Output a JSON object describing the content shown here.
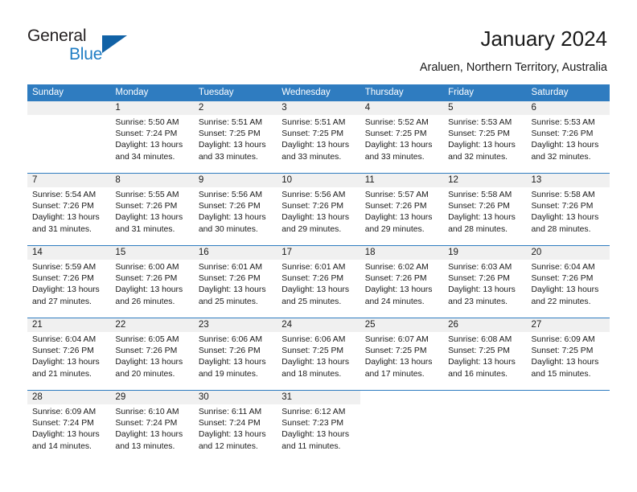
{
  "brand": {
    "name_part1": "General",
    "name_part2": "Blue",
    "accent_color": "#1162a6",
    "blue_text_color": "#1f7dc4",
    "logo_icon": "triangle-icon"
  },
  "header": {
    "title": "January 2024",
    "subtitle": "Araluen, Northern Territory, Australia"
  },
  "calendar": {
    "header_background": "#2f7cc0",
    "daynum_background": "#f0f0f0",
    "weekdays": [
      "Sunday",
      "Monday",
      "Tuesday",
      "Wednesday",
      "Thursday",
      "Friday",
      "Saturday"
    ],
    "weeks": [
      [
        {
          "day": "",
          "lines": []
        },
        {
          "day": "1",
          "lines": [
            "Sunrise: 5:50 AM",
            "Sunset: 7:24 PM",
            "Daylight: 13 hours",
            "and 34 minutes."
          ]
        },
        {
          "day": "2",
          "lines": [
            "Sunrise: 5:51 AM",
            "Sunset: 7:25 PM",
            "Daylight: 13 hours",
            "and 33 minutes."
          ]
        },
        {
          "day": "3",
          "lines": [
            "Sunrise: 5:51 AM",
            "Sunset: 7:25 PM",
            "Daylight: 13 hours",
            "and 33 minutes."
          ]
        },
        {
          "day": "4",
          "lines": [
            "Sunrise: 5:52 AM",
            "Sunset: 7:25 PM",
            "Daylight: 13 hours",
            "and 33 minutes."
          ]
        },
        {
          "day": "5",
          "lines": [
            "Sunrise: 5:53 AM",
            "Sunset: 7:25 PM",
            "Daylight: 13 hours",
            "and 32 minutes."
          ]
        },
        {
          "day": "6",
          "lines": [
            "Sunrise: 5:53 AM",
            "Sunset: 7:26 PM",
            "Daylight: 13 hours",
            "and 32 minutes."
          ]
        }
      ],
      [
        {
          "day": "7",
          "lines": [
            "Sunrise: 5:54 AM",
            "Sunset: 7:26 PM",
            "Daylight: 13 hours",
            "and 31 minutes."
          ]
        },
        {
          "day": "8",
          "lines": [
            "Sunrise: 5:55 AM",
            "Sunset: 7:26 PM",
            "Daylight: 13 hours",
            "and 31 minutes."
          ]
        },
        {
          "day": "9",
          "lines": [
            "Sunrise: 5:56 AM",
            "Sunset: 7:26 PM",
            "Daylight: 13 hours",
            "and 30 minutes."
          ]
        },
        {
          "day": "10",
          "lines": [
            "Sunrise: 5:56 AM",
            "Sunset: 7:26 PM",
            "Daylight: 13 hours",
            "and 29 minutes."
          ]
        },
        {
          "day": "11",
          "lines": [
            "Sunrise: 5:57 AM",
            "Sunset: 7:26 PM",
            "Daylight: 13 hours",
            "and 29 minutes."
          ]
        },
        {
          "day": "12",
          "lines": [
            "Sunrise: 5:58 AM",
            "Sunset: 7:26 PM",
            "Daylight: 13 hours",
            "and 28 minutes."
          ]
        },
        {
          "day": "13",
          "lines": [
            "Sunrise: 5:58 AM",
            "Sunset: 7:26 PM",
            "Daylight: 13 hours",
            "and 28 minutes."
          ]
        }
      ],
      [
        {
          "day": "14",
          "lines": [
            "Sunrise: 5:59 AM",
            "Sunset: 7:26 PM",
            "Daylight: 13 hours",
            "and 27 minutes."
          ]
        },
        {
          "day": "15",
          "lines": [
            "Sunrise: 6:00 AM",
            "Sunset: 7:26 PM",
            "Daylight: 13 hours",
            "and 26 minutes."
          ]
        },
        {
          "day": "16",
          "lines": [
            "Sunrise: 6:01 AM",
            "Sunset: 7:26 PM",
            "Daylight: 13 hours",
            "and 25 minutes."
          ]
        },
        {
          "day": "17",
          "lines": [
            "Sunrise: 6:01 AM",
            "Sunset: 7:26 PM",
            "Daylight: 13 hours",
            "and 25 minutes."
          ]
        },
        {
          "day": "18",
          "lines": [
            "Sunrise: 6:02 AM",
            "Sunset: 7:26 PM",
            "Daylight: 13 hours",
            "and 24 minutes."
          ]
        },
        {
          "day": "19",
          "lines": [
            "Sunrise: 6:03 AM",
            "Sunset: 7:26 PM",
            "Daylight: 13 hours",
            "and 23 minutes."
          ]
        },
        {
          "day": "20",
          "lines": [
            "Sunrise: 6:04 AM",
            "Sunset: 7:26 PM",
            "Daylight: 13 hours",
            "and 22 minutes."
          ]
        }
      ],
      [
        {
          "day": "21",
          "lines": [
            "Sunrise: 6:04 AM",
            "Sunset: 7:26 PM",
            "Daylight: 13 hours",
            "and 21 minutes."
          ]
        },
        {
          "day": "22",
          "lines": [
            "Sunrise: 6:05 AM",
            "Sunset: 7:26 PM",
            "Daylight: 13 hours",
            "and 20 minutes."
          ]
        },
        {
          "day": "23",
          "lines": [
            "Sunrise: 6:06 AM",
            "Sunset: 7:26 PM",
            "Daylight: 13 hours",
            "and 19 minutes."
          ]
        },
        {
          "day": "24",
          "lines": [
            "Sunrise: 6:06 AM",
            "Sunset: 7:25 PM",
            "Daylight: 13 hours",
            "and 18 minutes."
          ]
        },
        {
          "day": "25",
          "lines": [
            "Sunrise: 6:07 AM",
            "Sunset: 7:25 PM",
            "Daylight: 13 hours",
            "and 17 minutes."
          ]
        },
        {
          "day": "26",
          "lines": [
            "Sunrise: 6:08 AM",
            "Sunset: 7:25 PM",
            "Daylight: 13 hours",
            "and 16 minutes."
          ]
        },
        {
          "day": "27",
          "lines": [
            "Sunrise: 6:09 AM",
            "Sunset: 7:25 PM",
            "Daylight: 13 hours",
            "and 15 minutes."
          ]
        }
      ],
      [
        {
          "day": "28",
          "lines": [
            "Sunrise: 6:09 AM",
            "Sunset: 7:24 PM",
            "Daylight: 13 hours",
            "and 14 minutes."
          ]
        },
        {
          "day": "29",
          "lines": [
            "Sunrise: 6:10 AM",
            "Sunset: 7:24 PM",
            "Daylight: 13 hours",
            "and 13 minutes."
          ]
        },
        {
          "day": "30",
          "lines": [
            "Sunrise: 6:11 AM",
            "Sunset: 7:24 PM",
            "Daylight: 13 hours",
            "and 12 minutes."
          ]
        },
        {
          "day": "31",
          "lines": [
            "Sunrise: 6:12 AM",
            "Sunset: 7:23 PM",
            "Daylight: 13 hours",
            "and 11 minutes."
          ]
        },
        {
          "day": "",
          "lines": []
        },
        {
          "day": "",
          "lines": []
        },
        {
          "day": "",
          "lines": []
        }
      ]
    ]
  }
}
